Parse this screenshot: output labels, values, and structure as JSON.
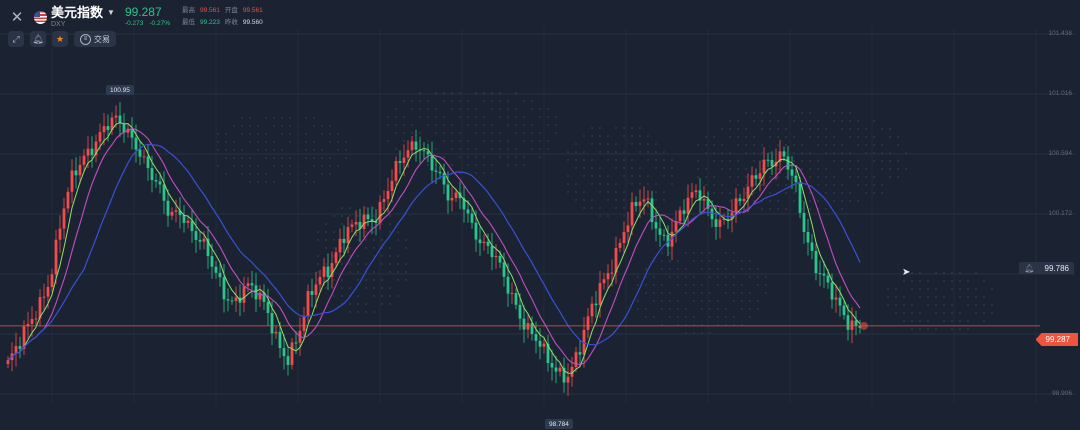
{
  "header": {
    "title": "美元指数",
    "symbol": "DXY",
    "price": "99.287",
    "change": "-0.273",
    "change_pct": "-0.27%",
    "stats": {
      "high_label": "最高",
      "high": "99.561",
      "open_label": "开盘",
      "open": "99.561",
      "low_label": "最低",
      "low": "99.223",
      "prev_close_label": "昨收",
      "prev_close": "99.560"
    }
  },
  "toolbar": {
    "trade_label": "交易"
  },
  "alert": {
    "value": "99.786"
  },
  "current_price_tag": "99.287",
  "callouts": {
    "high": "100.95",
    "low": "98.784"
  },
  "colors": {
    "background": "#1b2332",
    "up": "#ef4d4d",
    "down": "#2bc48a",
    "ma_fast": "#8fe06a",
    "ma_mid": "#c04fc0",
    "ma_slow": "#3a4fd8",
    "price_line": "#f0543d"
  },
  "icons": [
    "close-icon",
    "us-flag-icon",
    "chevron-down-icon",
    "draw-icon",
    "bell-icon",
    "star-icon",
    "trade-icon",
    "cursor-icon"
  ],
  "chart_data": {
    "type": "candlestick",
    "y_axis_ticks": [
      "101.438",
      "101.016",
      "100.594",
      "100.172",
      "98.906"
    ],
    "ylim": [
      98.72,
      101.55
    ],
    "high_marker": 100.95,
    "low_marker": 98.784,
    "current_price": 99.287,
    "alert_level": 99.786,
    "close_path": [
      99.0,
      99.1,
      99.3,
      99.5,
      99.7,
      100.1,
      100.4,
      100.6,
      100.72,
      100.8,
      100.82,
      100.78,
      100.7,
      100.5,
      100.3,
      100.1,
      100.2,
      100.05,
      99.9,
      99.7,
      99.55,
      99.5,
      99.6,
      99.5,
      99.4,
      99.2,
      99.05,
      99.2,
      99.5,
      99.7,
      99.8,
      99.95,
      100.0,
      100.1,
      100.15,
      100.3,
      100.45,
      100.6,
      100.72,
      100.6,
      100.4,
      100.2,
      100.3,
      100.1,
      99.9,
      99.8,
      99.65,
      99.5,
      99.3,
      99.15,
      99.0,
      98.95,
      98.95,
      99.1,
      99.35,
      99.6,
      99.8,
      100.0,
      100.15,
      100.25,
      100.1,
      99.95,
      100.05,
      100.2,
      100.35,
      100.2,
      100.05,
      100.1,
      100.25,
      100.45,
      100.55,
      100.5,
      100.55,
      100.4,
      100.0,
      99.7,
      99.55,
      99.45,
      99.35,
      99.29
    ]
  }
}
